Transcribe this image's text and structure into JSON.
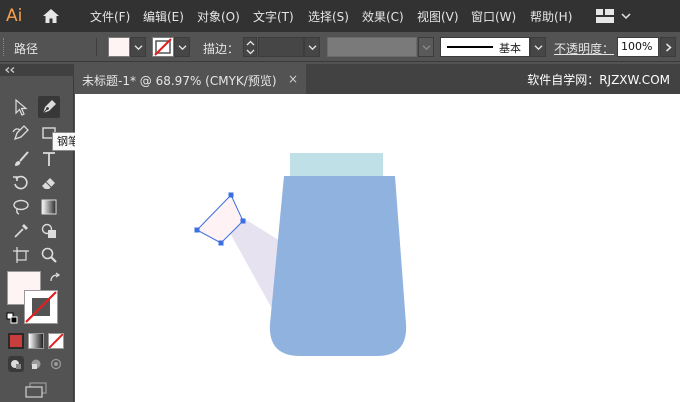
{
  "app": {
    "logo": "Ai"
  },
  "menu": {
    "items": [
      "文件(F)",
      "编辑(E)",
      "对象(O)",
      "文字(T)",
      "选择(S)",
      "效果(C)",
      "视图(V)",
      "窗口(W)",
      "帮助(H)"
    ]
  },
  "control_bar": {
    "selection_label": "路径",
    "stroke_label": "描边：",
    "brush_style": "基本",
    "opacity_label": "不透明度：",
    "opacity_value": "100%"
  },
  "document": {
    "tab_title": "未标题-1* @ 68.97% (CMYK/预览)",
    "close_glyph": "×",
    "site_credit": "软件自学网：RJZXW.COM"
  },
  "tooltip": {
    "text": "钢笔工具 (P)"
  },
  "colors": {
    "menubar_bg": "#323232",
    "ui_bg": "#535353",
    "accent_logo": "#f7a04b",
    "kettle_body": "#8fb2df",
    "kettle_lid": "#bfe0e6",
    "spout_shadow": "#e7e2f0",
    "spout_fill": "#fff2f4",
    "anchor_blue": "#3b6fe0",
    "fill_swatch": "#fff4f4"
  },
  "tools": [
    "selection-tool",
    "pen-tool",
    "curvature-tool",
    "rectangle-tool",
    "paintbrush-tool",
    "type-tool",
    "rotate-tool",
    "eraser-tool",
    "lasso-tool",
    "gradient-tool",
    "eyedropper-tool",
    "shape-builder-tool",
    "artboard-tool",
    "zoom-tool"
  ]
}
